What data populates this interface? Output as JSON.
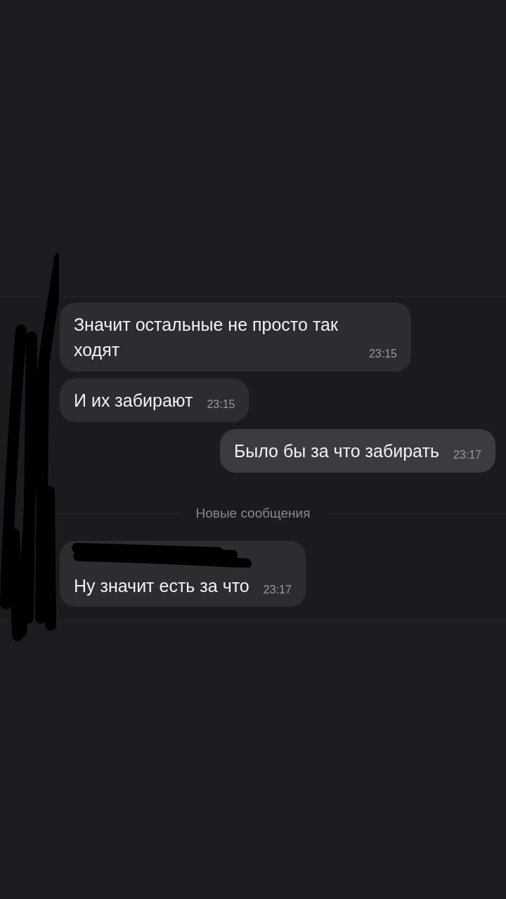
{
  "messages": [
    {
      "kind": "incoming",
      "text": "Значит остальные не просто так ходят",
      "time": "23:15",
      "redacted_sender": false
    },
    {
      "kind": "incoming",
      "text": "И их забирают",
      "time": "23:15",
      "redacted_sender": false
    },
    {
      "kind": "outgoing",
      "text": "Было бы за что забирать",
      "time": "23:17",
      "redacted_sender": false
    },
    {
      "kind": "divider",
      "text": "Новые сообщения"
    },
    {
      "kind": "incoming",
      "text": "Ну значит есть за что",
      "time": "23:17",
      "redacted_sender": true
    }
  ]
}
